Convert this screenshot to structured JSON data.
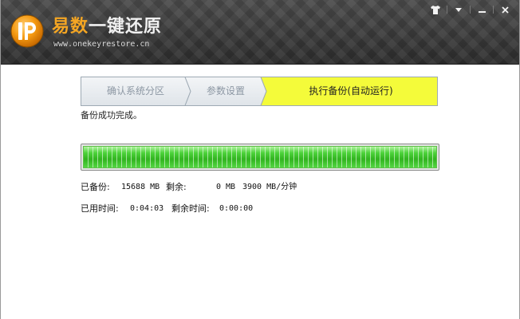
{
  "app": {
    "title_part1": "易数",
    "title_part2": "一键还原",
    "url": "www.onekeyrestore.cn",
    "logo_glyph": "P"
  },
  "window_controls": {
    "skin_icon": "shirt-icon",
    "menu_icon": "dropdown-arrow-icon",
    "minimize_icon": "minimize-icon",
    "close_icon": "close-icon"
  },
  "steps": [
    {
      "label": "确认系统分区",
      "state": "done"
    },
    {
      "label": "参数设置",
      "state": "done"
    },
    {
      "label": "执行备份(自动运行)",
      "state": "active"
    }
  ],
  "status": {
    "message": "备份成功完成。"
  },
  "progress": {
    "fraction": 1.0
  },
  "stats": {
    "backed_up_label": "已备份:",
    "backed_up_value": "15688 MB",
    "remaining_label": "剩余:",
    "remaining_value": "0 MB",
    "speed_value": "3900 MB/分钟",
    "elapsed_label": "已用时间:",
    "elapsed_value": "0:04:03",
    "time_left_label": "剩余时间:",
    "time_left_value": "0:00:00"
  },
  "colors": {
    "active_step_fill": "#f4fb3a",
    "inactive_step_fill": "#e5e9ed",
    "progress_green": "#43c42f",
    "brand_orange": "#f5a623"
  }
}
